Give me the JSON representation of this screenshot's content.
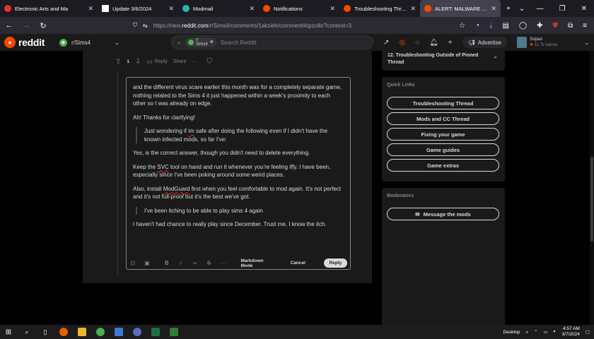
{
  "browser": {
    "tabs": [
      {
        "label": "Electronic Arts and Ma",
        "favicon_color": "#e8332a",
        "active": false
      },
      {
        "label": "Update 3/6/2024",
        "favicon_color": "#ffffff",
        "active": false
      },
      {
        "label": "Modmail",
        "favicon_color": "#2ab7a9",
        "active": false
      },
      {
        "label": "Notifications",
        "favicon_color": "#ff4500",
        "active": false
      },
      {
        "label": "Troubleshooting Thread - ",
        "favicon_color": "#ff4500",
        "active": false
      },
      {
        "label": "ALERT: MALWARE is being",
        "favicon_color": "#ff4500",
        "active": true
      }
    ],
    "new_tab": "+",
    "tab_list": "⌄",
    "url_prefix": "https://new.",
    "url_domain": "reddit.com",
    "url_path": "/r/Sims4/comments/1akzieh/comment/ktpzolb/?context=3"
  },
  "reddit": {
    "wordmark": "reddit",
    "community": "r/Sims4",
    "search_chip_line1": "r/",
    "search_chip_line2": "Sims4",
    "search_placeholder": "Search Reddit",
    "advertise": "Advertise",
    "username": "Sojian",
    "karma": "11.7k karma"
  },
  "comment_bar": {
    "votes": "1",
    "reply": "Reply",
    "share": "Share",
    "more": "···"
  },
  "editor": {
    "p1": "and the different virus scare earlier this month was for a completely separate game, nothing related to the Sims 4 it just happened within a week's proximity to each other so I was already on edge.",
    "p2": "Ah! Thanks for clarifying!",
    "q1_a": "Just wondering if ",
    "q1_b": "im",
    "q1_c": " safe after doing the following even if I didn't have the known infected mods, so far I've:",
    "p3": "Yes, is the correct answer, though you didn't need to delete everything.",
    "p4_a": "Keep the ",
    "p4_b": "SVC",
    "p4_c": " tool on hand and run it whenever you're feeling iffy. I have been, especially since I've been poking around some weird places.",
    "p5_a": "Also, install ",
    "p5_b": "ModGuard",
    "p5_c": " first when you feel comfortable to mod again. It's not perfect and it's not full-proof but it's the best we've got.",
    "q2": "I've been itching to be able to play sims 4 again",
    "p6": "I haven't had chance to really play since December. Trust me, I know the itch.",
    "toolbar_more": "···",
    "markdown_mode": "Markdown Mode",
    "cancel": "Cancel",
    "reply": "Reply"
  },
  "sidebar": {
    "rule": "12. Troubleshooting Outside of Pinned Thread",
    "quick_links_title": "Quick Links",
    "quick_links": [
      "Troubleshooting Thread",
      "Mods and CC Thread",
      "Fixing your game",
      "Game guides",
      "Game extras"
    ],
    "moderators_title": "Moderators",
    "message_mods": "Message the mods"
  },
  "taskbar": {
    "desktop": "Desktop",
    "time": "4:57 AM",
    "date": "3/7/2024"
  }
}
